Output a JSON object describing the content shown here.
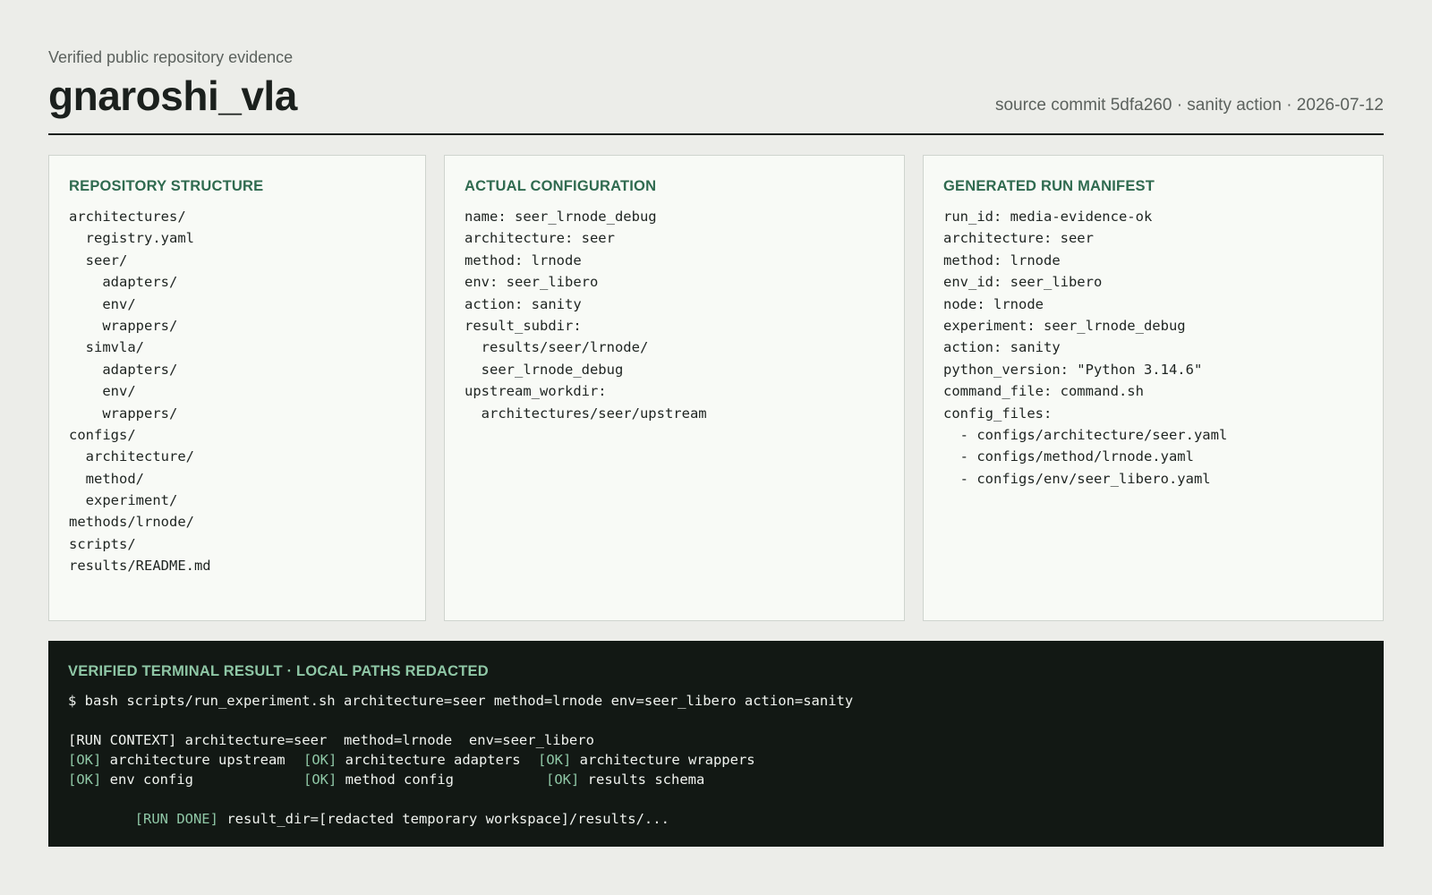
{
  "header": {
    "subtitle": "Verified public repository evidence",
    "title": "gnaroshi_vla",
    "meta": "source commit 5dfa260 · sanity action · 2026-07-12"
  },
  "cards": {
    "structure": {
      "title": "REPOSITORY STRUCTURE",
      "lines": [
        "architectures/",
        "  registry.yaml",
        "  seer/",
        "    adapters/",
        "    env/",
        "    wrappers/",
        "  simvla/",
        "    adapters/",
        "    env/",
        "    wrappers/",
        "configs/",
        "  architecture/",
        "  method/",
        "  experiment/",
        "methods/lrnode/",
        "scripts/",
        "results/README.md"
      ]
    },
    "config": {
      "title": "ACTUAL CONFIGURATION",
      "lines": [
        "name: seer_lrnode_debug",
        "architecture: seer",
        "method: lrnode",
        "env: seer_libero",
        "action: sanity",
        "result_subdir:",
        "  results/seer/lrnode/",
        "  seer_lrnode_debug",
        "upstream_workdir:",
        "  architectures/seer/upstream"
      ]
    },
    "manifest": {
      "title": "GENERATED RUN MANIFEST",
      "lines": [
        "run_id: media-evidence-ok",
        "architecture: seer",
        "method: lrnode",
        "env_id: seer_libero",
        "node: lrnode",
        "experiment: seer_lrnode_debug",
        "action: sanity",
        "python_version: \"Python 3.14.6\"",
        "command_file: command.sh",
        "config_files:",
        "  - configs/architecture/seer.yaml",
        "  - configs/method/lrnode.yaml",
        "  - configs/env/seer_libero.yaml"
      ]
    }
  },
  "terminal": {
    "title": "VERIFIED TERMINAL RESULT · LOCAL PATHS REDACTED",
    "command": "$ bash scripts/run_experiment.sh architecture=seer method=lrnode env=seer_libero action=sanity",
    "context": "[RUN CONTEXT] architecture=seer  method=lrnode  env=seer_libero",
    "checks": [
      [
        {
          "tag": "[OK]",
          "text": "architecture upstream"
        },
        {
          "tag": "[OK]",
          "text": "architecture adapters"
        },
        {
          "tag": "[OK]",
          "text": "architecture wrappers"
        }
      ],
      [
        {
          "tag": "[OK]",
          "text": "env config"
        },
        {
          "tag": "[OK]",
          "text": "method config"
        },
        {
          "tag": "[OK]",
          "text": "results schema"
        }
      ]
    ],
    "done": {
      "tag": "[RUN DONE]",
      "text": "result_dir=[redacted temporary workspace]/results/..."
    },
    "colors": {
      "ok_tag": "#8fc7a6",
      "background": "#121814"
    }
  }
}
